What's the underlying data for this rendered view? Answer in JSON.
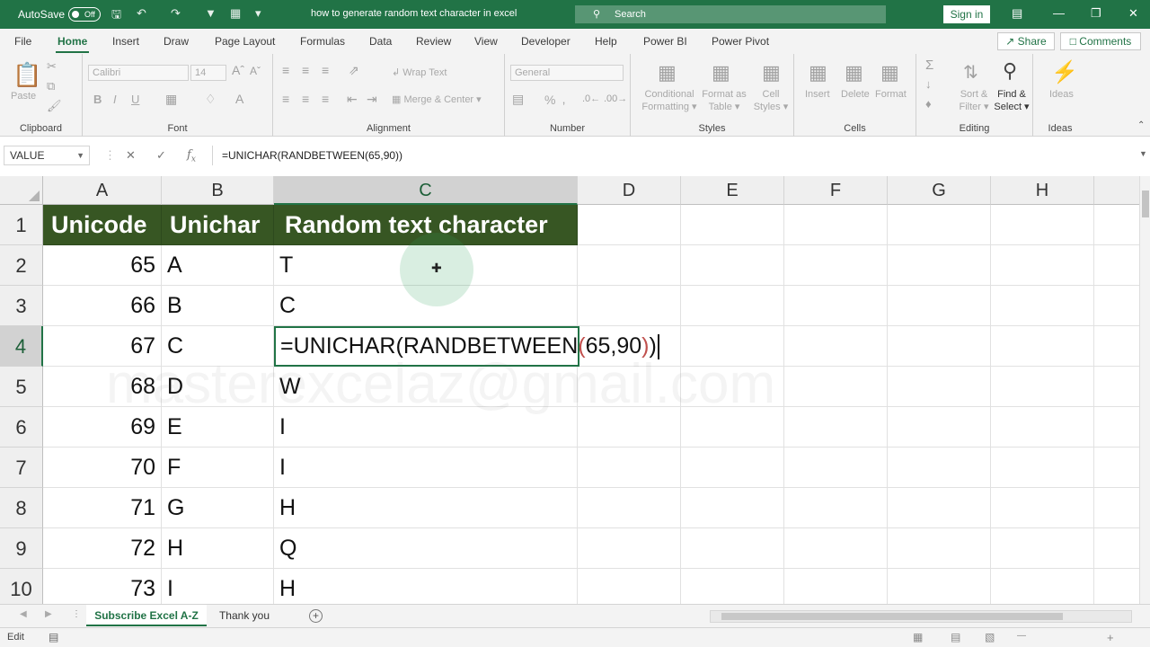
{
  "titlebar": {
    "autosave_label": "AutoSave",
    "autosave_state": "Off",
    "document_title": "how to generate random text character in excel",
    "search_placeholder": "Search",
    "signin_label": "Sign in",
    "accent_color": "#217346"
  },
  "menu": {
    "tabs": [
      "File",
      "Home",
      "Insert",
      "Draw",
      "Page Layout",
      "Formulas",
      "Data",
      "Review",
      "View",
      "Developer",
      "Help",
      "Power BI",
      "Power Pivot"
    ],
    "active_tab": "Home",
    "share_label": "Share",
    "comments_label": "Comments"
  },
  "ribbon": {
    "clipboard": {
      "name": "Clipboard",
      "paste": "Paste"
    },
    "font": {
      "name": "Font",
      "family": "Calibri",
      "size": "14",
      "bold": "B",
      "italic": "I",
      "underline": "U"
    },
    "alignment": {
      "name": "Alignment",
      "wrap_text": "Wrap Text",
      "merge_center": "Merge & Center"
    },
    "number": {
      "name": "Number",
      "format": "General",
      "percent": "%"
    },
    "styles": {
      "name": "Styles",
      "conditional": "Conditional",
      "formatting": "Formatting",
      "format_as": "Format as",
      "table": "Table",
      "cell": "Cell",
      "cell_styles": "Styles"
    },
    "cells": {
      "name": "Cells",
      "insert": "Insert",
      "delete": "Delete",
      "format": "Format"
    },
    "editing": {
      "name": "Editing",
      "sort": "Sort &",
      "filter": "Filter",
      "find": "Find &",
      "select": "Select"
    },
    "ideas": {
      "name": "Ideas",
      "ideas": "Ideas"
    }
  },
  "formula_bar": {
    "name_box": "VALUE",
    "formula": "=UNICHAR(RANDBETWEEN(65,90))"
  },
  "grid": {
    "columns": [
      "A",
      "B",
      "C",
      "D",
      "E",
      "F",
      "G",
      "H"
    ],
    "selected_column": "C",
    "rows": [
      "1",
      "2",
      "3",
      "4",
      "5",
      "6",
      "7",
      "8",
      "9",
      "10"
    ],
    "selected_row": "4",
    "headers": {
      "a": "Unicode",
      "b": "Unichar",
      "c": "Random text character"
    },
    "data": [
      {
        "a": "65",
        "b": "A",
        "c": "T"
      },
      {
        "a": "66",
        "b": "B",
        "c": "C"
      },
      {
        "a": "67",
        "b": "C",
        "c": ""
      },
      {
        "a": "68",
        "b": "D",
        "c": "W"
      },
      {
        "a": "69",
        "b": "E",
        "c": "I"
      },
      {
        "a": "70",
        "b": "F",
        "c": "I"
      },
      {
        "a": "71",
        "b": "G",
        "c": "H"
      },
      {
        "a": "72",
        "b": "H",
        "c": "Q"
      },
      {
        "a": "73",
        "b": "I",
        "c": "H"
      }
    ],
    "editing_cell": {
      "prefix": "=UNICHAR(RANDBETWEEN",
      "open": "(",
      "args": "65,90",
      "close1": ")",
      "close2": ")"
    },
    "header_fill": "#375623",
    "watermark_text": "masterexcelaz@gmail.com"
  },
  "sheets": {
    "tabs": [
      "Subscribe Excel A-Z",
      "Thank you"
    ],
    "active": "Subscribe Excel A-Z",
    "add_icon": "+"
  },
  "statusbar": {
    "mode": "Edit"
  }
}
